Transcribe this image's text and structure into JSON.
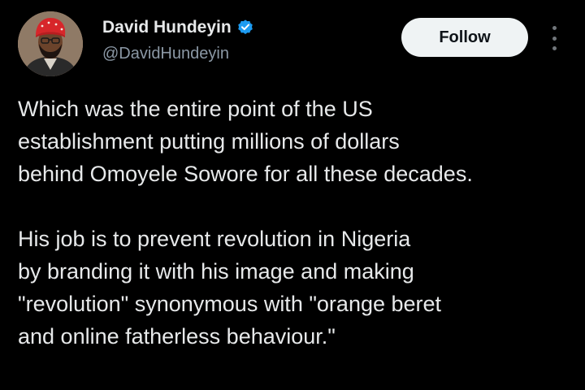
{
  "author": {
    "display_name": "David Hundeyin",
    "handle": "@DavidHundeyin",
    "verified": true,
    "verified_color": "#1d9bf0"
  },
  "actions": {
    "follow_label": "Follow",
    "more_icon": "more-vertical-icon"
  },
  "tweet": {
    "paragraphs": [
      {
        "lines": [
          "Which was the entire point of the US",
          "establishment putting millions of dollars",
          "behind Omoyele Sowore for all these decades."
        ]
      },
      {
        "lines": [
          "His job is to prevent revolution in Nigeria",
          "by branding it with his image and making",
          "\"revolution\" synonymous with \"orange beret",
          "and online fatherless behaviour.\""
        ]
      }
    ]
  },
  "colors": {
    "background": "#000000",
    "text": "#e7e9ea",
    "secondary_text": "#8b98a5",
    "button_bg": "#eff3f4",
    "button_text": "#0f1419"
  }
}
